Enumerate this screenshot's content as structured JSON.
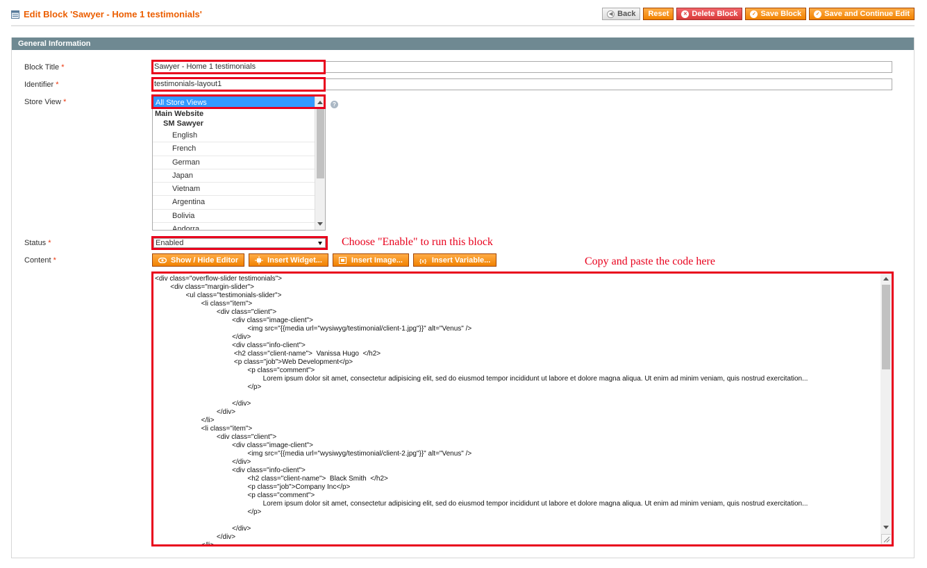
{
  "header": {
    "title": "Edit Block 'Sawyer - Home 1 testimonials'",
    "buttons": {
      "back": "Back",
      "reset": "Reset",
      "delete": "Delete Block",
      "save": "Save Block",
      "save_continue": "Save and Continue Edit"
    }
  },
  "fieldset": {
    "legend": "General Information"
  },
  "form": {
    "block_title": {
      "label": "Block Title",
      "required": "*",
      "value": "Sawyer - Home 1 testimonials"
    },
    "identifier": {
      "label": "Identifier",
      "required": "*",
      "value": "testimonials-layout1"
    },
    "store_view": {
      "label": "Store View",
      "required": "*",
      "selected": "All Store Views",
      "group": "Main Website",
      "subgroup": "SM Sawyer",
      "options": [
        "English",
        "French",
        "German",
        "Japan",
        "Vietnam",
        "Argentina",
        "Bolivia",
        "Andorra"
      ]
    },
    "status": {
      "label": "Status",
      "required": "*",
      "value": "Enabled"
    },
    "content": {
      "label": "Content",
      "required": "*"
    }
  },
  "editor_buttons": {
    "show_hide": "Show / Hide Editor",
    "insert_widget": "Insert Widget...",
    "insert_image": "Insert Image...",
    "insert_variable": "Insert Variable..."
  },
  "annotations": {
    "status_note": "Choose \"Enable\" to run this block",
    "content_note": "Copy and paste the code here"
  },
  "code_lines": [
    "<div class=\"overflow-slider testimonials\">",
    "        <div class=\"margin-slider\">",
    "                <ul class=\"testimonials-slider\">",
    "                        <li class=\"item\">",
    "                                <div class=\"client\">",
    "                                        <div class=\"image-client\">",
    "                                                <img src=\"{{media url=\"wysiwyg/testimonial/client-1.jpg\"}}\" alt=\"Venus\" />",
    "                                        </div>",
    "                                        <div class=\"info-client\">",
    "                                         <h2 class=\"client-name\">  Vanissa Hugo  </h2>",
    "                                         <p class=\"job\">Web Development</p>",
    "                                                <p class=\"comment\">",
    "                                                        Lorem ipsum dolor sit amet, consectetur adipisicing elit, sed do eiusmod tempor incididunt ut labore et dolore magna aliqua. Ut enim ad minim veniam, quis nostrud exercitation...",
    "                                                </p>",
    "",
    "                                        </div>",
    "                                </div>",
    "                        </li>",
    "                        <li class=\"item\">",
    "                                <div class=\"client\">",
    "                                        <div class=\"image-client\">",
    "                                                <img src=\"{{media url=\"wysiwyg/testimonial/client-2.jpg\"}}\" alt=\"Venus\" />",
    "                                        </div>",
    "                                        <div class=\"info-client\">",
    "                                                <h2 class=\"client-name\">  Black Smith  </h2>",
    "                                                <p class=\"job\">Company Inc</p>",
    "                                                <p class=\"comment\">",
    "                                                        Lorem ipsum dolor sit amet, consectetur adipisicing elit, sed do eiusmod tempor incididunt ut labore et dolore magna aliqua. Ut enim ad minim veniam, quis nostrud exercitation...",
    "                                                </p>",
    "",
    "                                        </div>",
    "                                </div>",
    "                        </li>"
  ],
  "colors": {
    "accent": "#eb5e00",
    "annotation_red": "#e8001c",
    "legend_bg": "#6f8992",
    "selected_bg": "#3399ff"
  }
}
